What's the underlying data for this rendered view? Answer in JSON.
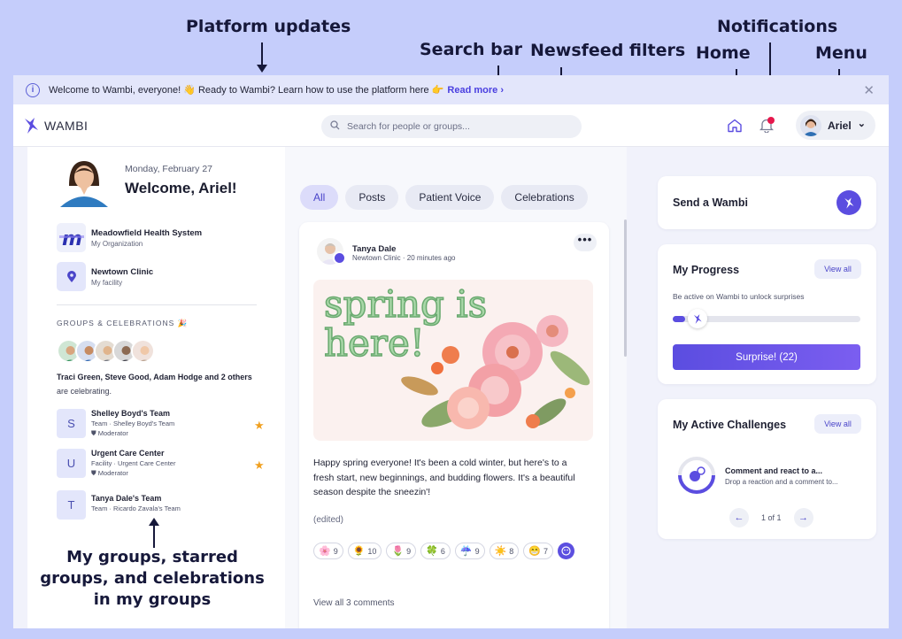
{
  "annotations": {
    "platform_updates": "Platform updates",
    "search_bar": "Search bar",
    "newsfeed_filters": "Newsfeed filters",
    "home": "Home",
    "notifications": "Notifications",
    "menu": "Menu",
    "groups_caption": "My groups, starred groups, and celebrations in my groups"
  },
  "banner": {
    "text": "Welcome to Wambi, everyone! 👋 Ready to Wambi? Learn how to use the platform here 👉",
    "link": "Read more",
    "link_chevron": "›",
    "close": "✕"
  },
  "topbar": {
    "logo_text": "WAMBI",
    "search_placeholder": "Search for people or groups...",
    "user_name": "Ariel",
    "user_chevron": "⌄"
  },
  "profile": {
    "date": "Monday, February 27",
    "welcome": "Welcome, Ariel!"
  },
  "organization": {
    "name": "Meadowfield Health System",
    "label": "My Organization"
  },
  "facility": {
    "name": "Newtown Clinic",
    "label": "My facility"
  },
  "groups": {
    "section_title": "GROUPS & CELEBRATIONS",
    "section_emoji": "🎉",
    "celebration_names": "Traci Green, Steve Good, Adam Hodge and 2 others",
    "celebration_suffix": "are celebrating.",
    "items": [
      {
        "initial": "S",
        "name": "Shelley Boyd's Team",
        "detail": "Team · Shelley Boyd's Team",
        "role": "Moderator",
        "starred": true
      },
      {
        "initial": "U",
        "name": "Urgent Care Center",
        "detail": "Facility · Urgent Care Center",
        "role": "Moderator",
        "starred": true
      },
      {
        "initial": "T",
        "name": "Tanya Dale's Team",
        "detail": "Team · Ricardo Zavala's Team",
        "role": "",
        "starred": false
      }
    ]
  },
  "feed": {
    "filters": [
      "All",
      "Posts",
      "Patient Voice",
      "Celebrations"
    ],
    "active_filter": "All",
    "post": {
      "author": "Tanya Dale",
      "meta": "Newtown Clinic · 20 minutes ago",
      "more": "•••",
      "image_text_line1": "spring is",
      "image_text_line2": "here!",
      "text": "Happy spring everyone! It's been a cold winter, but here's to a fresh start, new beginnings, and budding flowers. It's a beautiful season despite the sneezin'!",
      "edited": "(edited)",
      "reactions": [
        {
          "emoji": "🌸",
          "count": "9"
        },
        {
          "emoji": "🌻",
          "count": "10"
        },
        {
          "emoji": "🌷",
          "count": "9"
        },
        {
          "emoji": "🍀",
          "count": "6"
        },
        {
          "emoji": "☔",
          "count": "9"
        },
        {
          "emoji": "☀️",
          "count": "8"
        },
        {
          "emoji": "😁",
          "count": "7"
        }
      ],
      "view_comments": "View all 3 comments"
    }
  },
  "right": {
    "send_wambi": "Send a Wambi",
    "progress": {
      "title": "My Progress",
      "view_all": "View all",
      "hint": "Be active on Wambi to unlock surprises",
      "button": "Surprise! (22)"
    },
    "challenges": {
      "title": "My Active Challenges",
      "view_all": "View all",
      "item_title": "Comment and react to a...",
      "item_desc": "Drop a reaction and a comment to...",
      "pager": "1 of 1",
      "prev": "←",
      "next": "→"
    }
  },
  "colors": {
    "background": "#c5cdfb",
    "accent": "#5b4de0",
    "star": "#f0a020",
    "notification_dot": "#e6174c"
  }
}
